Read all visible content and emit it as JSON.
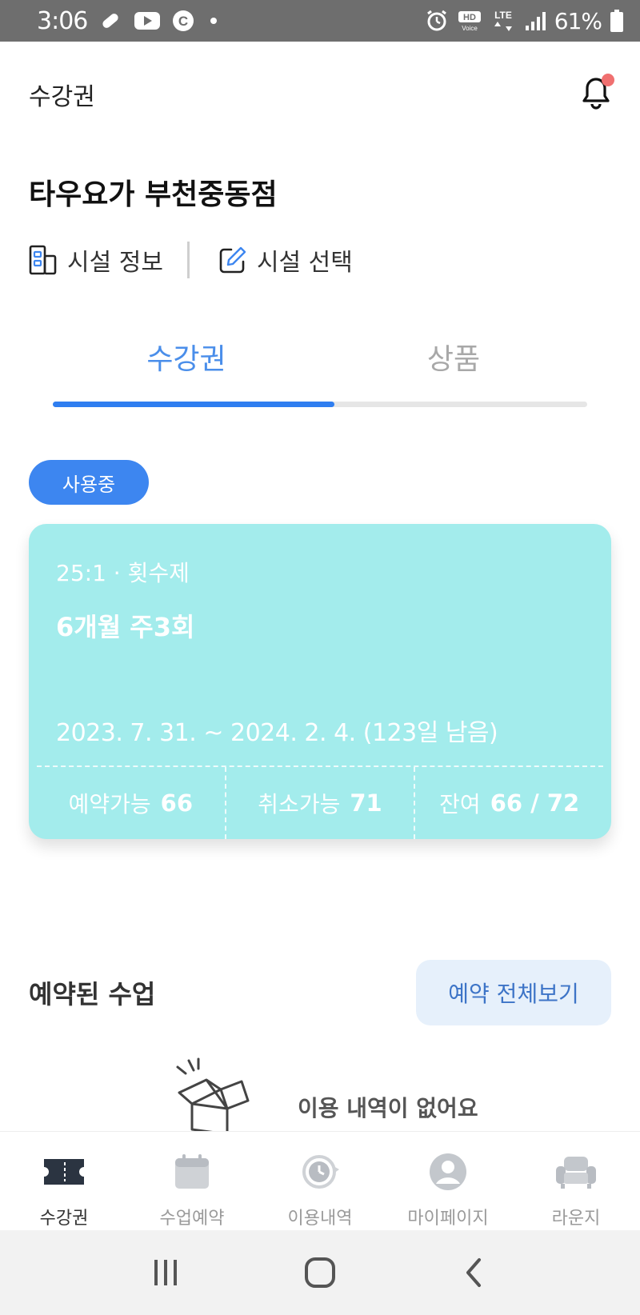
{
  "status_bar": {
    "time": "3:06",
    "battery": "61%",
    "icons": [
      "link-icon",
      "youtube-icon",
      "c-icon",
      "dot-icon",
      "alarm-icon",
      "hd-voice-icon",
      "lte-icon",
      "signal-icon",
      "battery-icon"
    ]
  },
  "header": {
    "title": "수강권",
    "has_notification_badge": true
  },
  "facility": {
    "name": "타우요가 부천중동점",
    "info_label": "시설 정보",
    "select_label": "시설 선택"
  },
  "tabs": [
    {
      "label": "수강권",
      "active": true
    },
    {
      "label": "상품",
      "active": false
    }
  ],
  "ticket": {
    "status_label": "사용중",
    "sub": "25:1 · 횟수제",
    "title": "6개월 주3회",
    "period": "2023. 7. 31. ~ 2024. 2. 4. (123일 남음)",
    "stats": [
      {
        "label": "예약가능",
        "value": "66"
      },
      {
        "label": "취소가능",
        "value": "71"
      },
      {
        "label": "잔여",
        "value": "66 / 72"
      }
    ],
    "color": "#a3ecec"
  },
  "reserved": {
    "title": "예약된 수업",
    "view_all_label": "예약 전체보기",
    "empty_text": "이용 내역이 없어요"
  },
  "bottom_nav": [
    {
      "label": "수강권",
      "icon": "ticket-icon",
      "active": true
    },
    {
      "label": "수업예약",
      "icon": "calendar-icon",
      "active": false
    },
    {
      "label": "이용내역",
      "icon": "history-icon",
      "active": false
    },
    {
      "label": "마이페이지",
      "icon": "user-icon",
      "active": false
    },
    {
      "label": "라운지",
      "icon": "sofa-icon",
      "active": false
    }
  ],
  "colors": {
    "accent": "#2f7ef0",
    "tab_active_text": "#4a8eea",
    "pill": "#3d86f0",
    "button_bg": "#e6f0fb",
    "badge": "#f07070"
  }
}
